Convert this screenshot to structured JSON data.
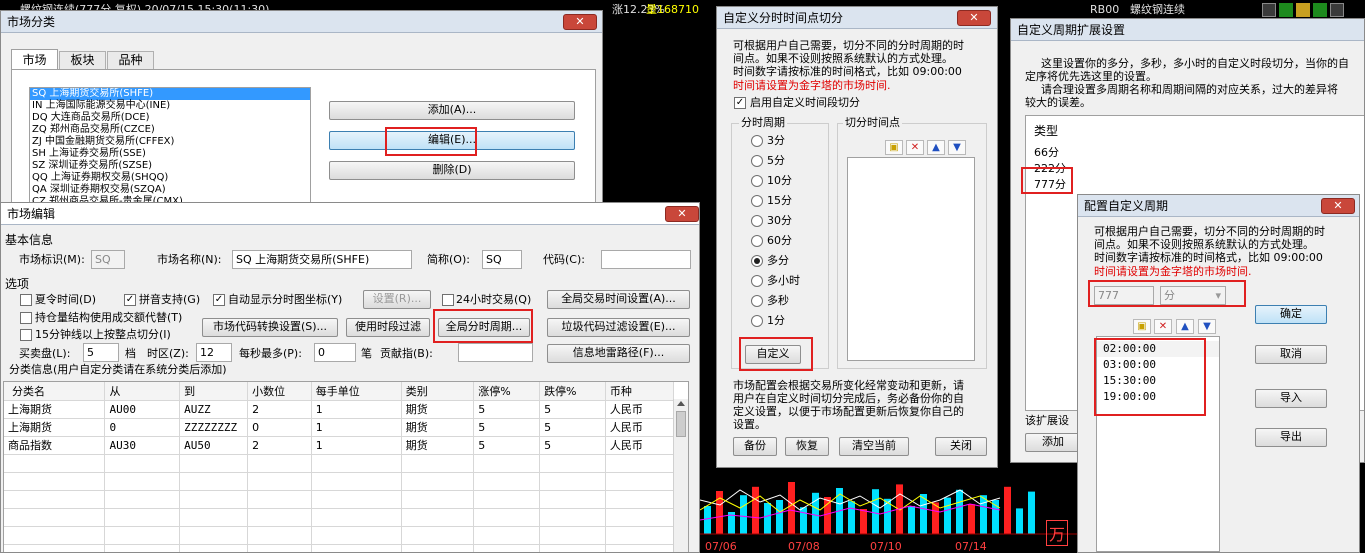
{
  "background": {
    "top_text_left": "螺纹钢连续(777分 复权) 20/07/15 15:30(11:30)",
    "top_text_mid": "涨12.23%",
    "top_text_vol": "量168710",
    "top_text_code": "RB00",
    "top_text_name": "螺纹钢连续",
    "chart_price": "万",
    "chart_dates": [
      "07/06",
      "07/08",
      "07/10",
      "07/14"
    ]
  },
  "market_class_win": {
    "title": "市场分类",
    "close_label": "✕",
    "tabs": [
      "市场",
      "板块",
      "品种"
    ],
    "markets": [
      "SQ 上海期货交易所(SHFE)",
      "IN 上海国际能源交易中心(INE)",
      "DQ 大连商品交易所(DCE)",
      "ZQ 郑州商品交易所(CZCE)",
      "ZJ 中国金融期货交易所(CFFEX)",
      "SH 上海证券交易所(SSE)",
      "SZ 深圳证券交易所(SZSE)",
      "QQ 上海证券期权交易(SHQQ)",
      "QA 深圳证券期权交易(SZQA)",
      "CZ 郑州商品交易所-贵金属(CMX)"
    ],
    "add_label": "添加(A)...",
    "edit_label": "编辑(E)...",
    "delete_label": "删除(D)"
  },
  "market_edit_win": {
    "title": "市场编辑",
    "basic_info": "基本信息",
    "market_id_label": "市场标识(M):",
    "market_id_value": "SQ",
    "market_name_label": "市场名称(N):",
    "market_name_value": "SQ 上海期货交易所(SHFE)",
    "short_label": "简称(O):",
    "short_value": "SQ",
    "code_label": "代码(C):",
    "code_value": "",
    "options": "选项",
    "opt_summer": "夏令时间(D)",
    "opt_pinyin": "拼音支持(G)",
    "opt_autoshow": "自动显示分时图坐标(Y)",
    "settings_label": "设置(R)...",
    "opt_24h": "24小时交易(Q)",
    "global_trade_time": "全局交易时间设置(A)...",
    "opt_position": "持仓量结构使用成交额代替(T)",
    "code_convert": "市场代码转换设置(S)...",
    "use_time_filter": "使用时段过滤",
    "global_period": "全局分时周期...",
    "garbage_filter": "垃圾代码过滤设置(E)...",
    "opt_15min": "15分钟线以上按整点切分(I)",
    "bid_label": "买卖盘(L):",
    "bid_value": "5",
    "bid_unit": "档",
    "zone_label": "时区(Z):",
    "zone_value": "12",
    "per_sec_label": "每秒最多(P):",
    "per_sec_value": "0",
    "per_sec_unit": "笔",
    "contrib_label": "贡献指(B):",
    "info_mine": "信息地雷路径(F)...",
    "class_info": "分类信息(用户自定分类请在系统分类后添加)",
    "columns": [
      "分类名",
      "从",
      "到",
      "小数位",
      "每手单位",
      "类别",
      "涨停%",
      "跌停%",
      "币种"
    ],
    "rows": [
      [
        "上海期货",
        "AU00",
        "AUZZ",
        "2",
        "1",
        "期货",
        "5",
        "5",
        "人民币"
      ],
      [
        "上海期货",
        "0",
        "ZZZZZZZZ",
        "0",
        "1",
        "期货",
        "5",
        "5",
        "人民币"
      ],
      [
        "商品指数",
        "AU30",
        "AU50",
        "2",
        "1",
        "期货",
        "5",
        "5",
        "人民币"
      ]
    ]
  },
  "custom_split_win": {
    "title": "自定义分时时间点切分",
    "desc1": "可根据用户自己需要，切分不同的分时周期的时",
    "desc2": "间点。如果不设则按照系统默认的方式处理。",
    "desc3": "时间数字请按标准的时间格式，比如 09:00:00",
    "desc_red": "时间请设置为金字塔的市场时间.",
    "enable_label": "启用自定义时间段切分",
    "period_group": "分时周期",
    "periods": [
      "3分",
      "5分",
      "10分",
      "15分",
      "30分",
      "60分",
      "多分",
      "多小时",
      "多秒",
      "1分"
    ],
    "selected_period": "多分",
    "custom_btn": "自定义",
    "points_group": "切分时间点",
    "note1": "市场配置会根据交易所变化经常变动和更新，请",
    "note2": "用户在自定义时间切分完成后，务必备份你的自",
    "note3": "定义设置，以便于市场配置更新后恢复你自己的",
    "note4": "设置。",
    "backup": "备份",
    "restore": "恢复",
    "clear": "清空当前",
    "close": "关闭"
  },
  "ext_period_win": {
    "title": "自定义周期扩展设置",
    "desc1": "这里设置你的多分，多秒，多小时的自定义时段切分，当你的自",
    "desc2": "定序将优先选这里的设置。",
    "desc3": "请合理设置多周期名称和周期间隔的对应关系，过大的差异将",
    "desc4": "较大的误差。",
    "type_header": "类型",
    "types": [
      "66分",
      "222分",
      "777分"
    ],
    "ext_label": "该扩展设",
    "add_btn": "添加"
  },
  "config_win": {
    "title": "配置自定义周期",
    "desc1": "可根据用户自己需要，切分不同的分时周期的时",
    "desc2": "间点。如果不设则按照系统默认的方式处理。",
    "desc3": "时间数字请按标准的时间格式，比如 09:00:00",
    "desc_red": "时间请设置为金字塔的市场时间.",
    "num_value": "777",
    "unit_value": "分",
    "times": [
      "02:00:00",
      "03:00:00",
      "15:30:00",
      "19:00:00"
    ],
    "ok": "确定",
    "cancel": "取消",
    "import": "导入",
    "export": "导出"
  }
}
